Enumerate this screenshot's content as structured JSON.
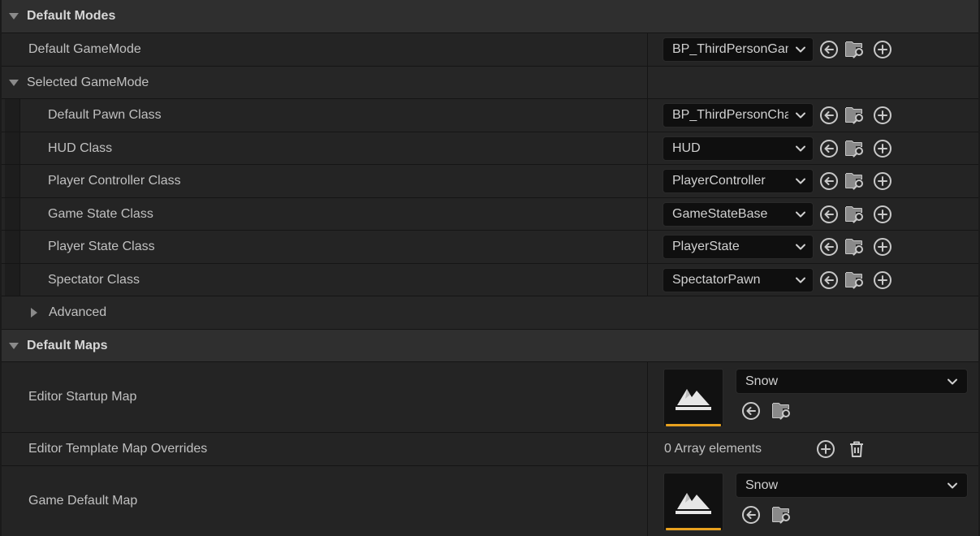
{
  "sections": {
    "default_modes": "Default Modes",
    "selected_gamemode": "Selected GameMode",
    "advanced": "Advanced",
    "default_maps": "Default Maps"
  },
  "default_gamemode": {
    "label": "Default GameMode",
    "value": "BP_ThirdPersonGameMode"
  },
  "classes": [
    {
      "label": "Default Pawn Class",
      "value": "BP_ThirdPersonCharacter"
    },
    {
      "label": "HUD Class",
      "value": "HUD"
    },
    {
      "label": "Player Controller Class",
      "value": "PlayerController"
    },
    {
      "label": "Game State Class",
      "value": "GameStateBase"
    },
    {
      "label": "Player State Class",
      "value": "PlayerState"
    },
    {
      "label": "Spectator Class",
      "value": "SpectatorPawn"
    }
  ],
  "editor_startup_map": {
    "label": "Editor Startup Map",
    "value": "Snow"
  },
  "editor_template_map_overrides": {
    "label": "Editor Template Map Overrides",
    "value": "0 Array elements"
  },
  "game_default_map": {
    "label": "Game Default Map",
    "value": "Snow"
  },
  "colors": {
    "accent": "#e8a11f",
    "background": "#1a1a1a",
    "row": "#242424",
    "header": "#2f2f2f"
  },
  "icons": [
    "triangle-down-icon",
    "triangle-right-icon",
    "chevron-down-icon",
    "use-selected-arrow-icon",
    "browse-folder-icon",
    "add-circle-icon",
    "trash-icon",
    "map-thumbnail-icon"
  ]
}
